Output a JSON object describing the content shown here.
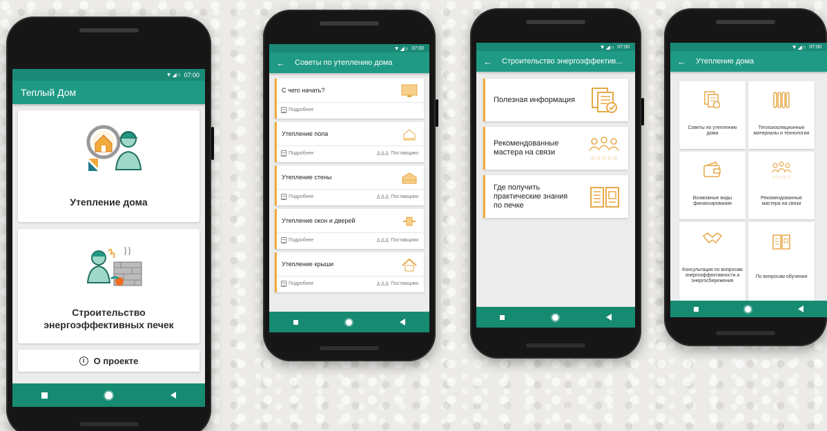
{
  "colors": {
    "primary": "#1f9a84",
    "primary_dark": "#178a72",
    "accent": "#f2a93b"
  },
  "status": {
    "time": "07:00"
  },
  "screens": {
    "home": {
      "title": "Теплый Дом",
      "cards": [
        {
          "label": "Утепление дома",
          "icon": "house-insulation-icon"
        },
        {
          "label": "Строительство энергоэффективных печек",
          "icon": "stove-builder-icon"
        }
      ],
      "about_label": "О проекте"
    },
    "tips": {
      "title": "Советы по утеплению дома",
      "items": [
        {
          "title": "С чего начать?",
          "more": "Подробнее",
          "suppliers": ""
        },
        {
          "title": "Утепление пола",
          "more": "Подробнее",
          "suppliers": "Поставщики"
        },
        {
          "title": "Утепление стены",
          "more": "Подробнее",
          "suppliers": "Поставщики"
        },
        {
          "title": "Утепление окон и дверей",
          "more": "Подробнее",
          "suppliers": "Поставщики"
        },
        {
          "title": "Утепление крыши",
          "more": "Подробнее",
          "suppliers": "Поставщики"
        }
      ]
    },
    "stoves": {
      "title": "Строительство энергоэффектив...",
      "items": [
        {
          "title": "Полезная информация",
          "icon": "document-check-icon"
        },
        {
          "title": "Рекомендованные мастера на связи",
          "icon": "rated-masters-icon"
        },
        {
          "title": "Где получить практические знания по печке",
          "icon": "open-book-icon"
        }
      ]
    },
    "insulation": {
      "title": "Утепление дома",
      "tiles": [
        {
          "label": "Советы по утеплению дома",
          "icon": "document-check-icon"
        },
        {
          "label": "Теплоизоляционные материалы и технологии",
          "icon": "radiator-icon"
        },
        {
          "label": "Возможные виды финансирования",
          "icon": "wallet-icon"
        },
        {
          "label": "Рекомендованные мастера на связи",
          "icon": "rated-masters-icon"
        },
        {
          "label": "Консультация по вопросам энергоэффективности и энергосбережения",
          "icon": "handshake-icon"
        },
        {
          "label": "По вопросам обучения",
          "icon": "open-book-icon"
        }
      ]
    }
  }
}
